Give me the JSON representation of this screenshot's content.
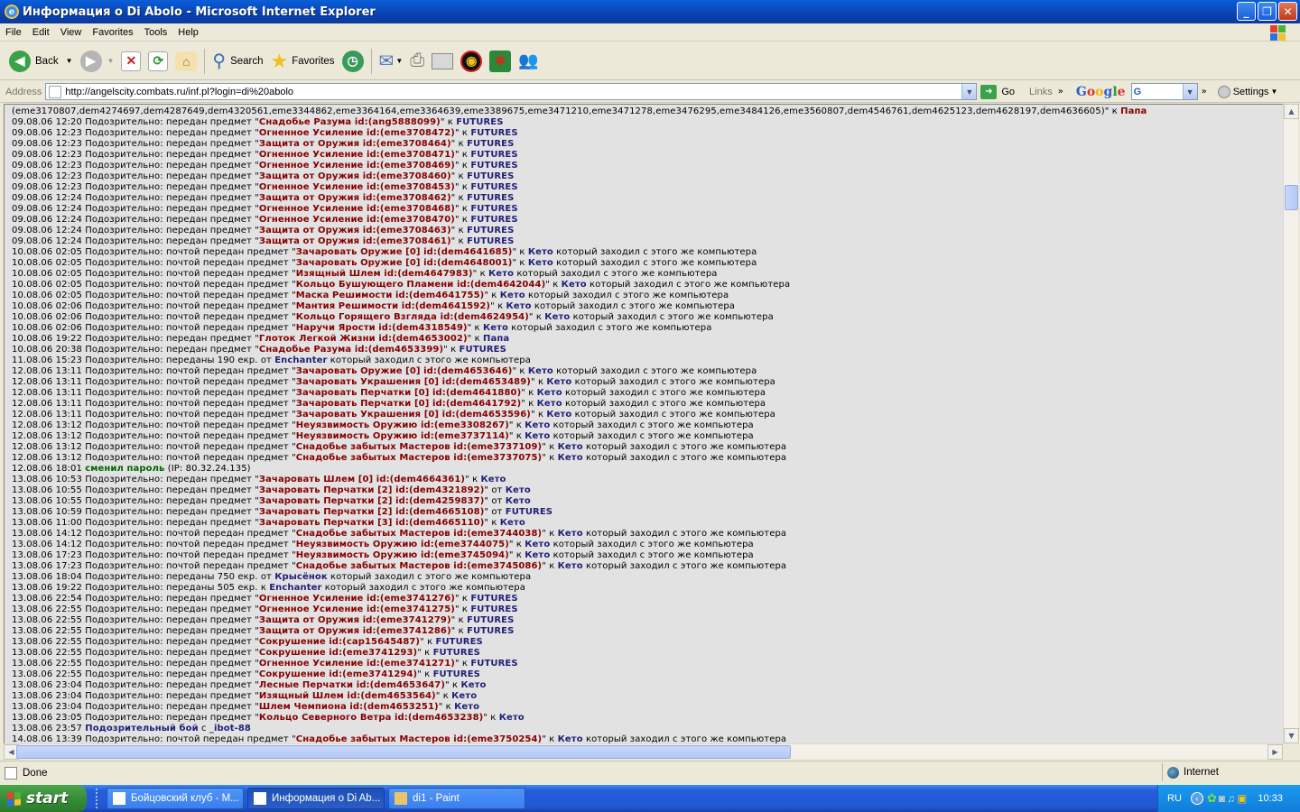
{
  "window": {
    "title": "Информация о Di Abolo - Microsoft Internet Explorer"
  },
  "menu": [
    "File",
    "Edit",
    "View",
    "Favorites",
    "Tools",
    "Help"
  ],
  "toolbar": {
    "back": "Back",
    "search": "Search",
    "favorites": "Favorites"
  },
  "address": {
    "label": "Address",
    "url": "http://angelscity.combats.ru/inf.pl?login=di%20abolo",
    "go": "Go",
    "links": "Links",
    "google": "Google",
    "google_field": "G",
    "settings": "Settings"
  },
  "log_lines": [
    [
      "(eme3170807,dem4274697,dem4287649,dem4320561,eme3344862,eme3364164,eme3364639,eme3389675,eme3471210,eme3471278,eme3476295,eme3484126,eme3560807,dem4546761,dem4625123,dem4628197,dem4636605)\" к ",
      "Папа",
      "",
      ""
    ],
    [
      "09.08.06 12:20 Подозрительно: передан предмет \"",
      "Снадобье Разума id:(ang5888099)",
      "\" к ",
      "FUTURES"
    ],
    [
      "09.08.06 12:23 Подозрительно: передан предмет \"",
      "Огненное Усиление id:(eme3708472)",
      "\" к ",
      "FUTURES"
    ],
    [
      "09.08.06 12:23 Подозрительно: передан предмет \"",
      "Защита от Оружия id:(eme3708464)",
      "\" к ",
      "FUTURES"
    ],
    [
      "09.08.06 12:23 Подозрительно: передан предмет \"",
      "Огненное Усиление id:(eme3708471)",
      "\" к ",
      "FUTURES"
    ],
    [
      "09.08.06 12:23 Подозрительно: передан предмет \"",
      "Огненное Усиление id:(eme3708469)",
      "\" к ",
      "FUTURES"
    ],
    [
      "09.08.06 12:23 Подозрительно: передан предмет \"",
      "Защита от Оружия id:(eme3708460)",
      "\" к ",
      "FUTURES"
    ],
    [
      "09.08.06 12:23 Подозрительно: передан предмет \"",
      "Огненное Усиление id:(eme3708453)",
      "\" к ",
      "FUTURES"
    ],
    [
      "09.08.06 12:24 Подозрительно: передан предмет \"",
      "Защита от Оружия id:(eme3708462)",
      "\" к ",
      "FUTURES"
    ],
    [
      "09.08.06 12:24 Подозрительно: передан предмет \"",
      "Огненное Усиление id:(eme3708468)",
      "\" к ",
      "FUTURES"
    ],
    [
      "09.08.06 12:24 Подозрительно: передан предмет \"",
      "Огненное Усиление id:(eme3708470)",
      "\" к ",
      "FUTURES"
    ],
    [
      "09.08.06 12:24 Подозрительно: передан предмет \"",
      "Защита от Оружия id:(eme3708463)",
      "\" к ",
      "FUTURES"
    ],
    [
      "09.08.06 12:24 Подозрительно: передан предмет \"",
      "Защита от Оружия id:(eme3708461)",
      "\" к ",
      "FUTURES"
    ],
    [
      "10.08.06 02:05 Подозрительно: почтой передан предмет \"",
      "Зачаровать Оружие [0] id:(dem4641685)",
      "\" к ",
      "Кето",
      "который заходил с этого же компьютера"
    ],
    [
      "10.08.06 02:05 Подозрительно: почтой передан предмет \"",
      "Зачаровать Оружие [0] id:(dem4648001)",
      "\" к ",
      "Кето",
      "который заходил с этого же компьютера"
    ],
    [
      "10.08.06 02:05 Подозрительно: почтой передан предмет \"",
      "Изящный Шлем id:(dem4647983)",
      "\" к ",
      "Кето",
      "который заходил с этого же компьютера"
    ],
    [
      "10.08.06 02:05 Подозрительно: почтой передан предмет \"",
      "Кольцо Бушующего Пламени id:(dem4642044)",
      "\" к ",
      "Кето",
      "который заходил с этого же компьютера"
    ],
    [
      "10.08.06 02:05 Подозрительно: почтой передан предмет \"",
      "Маска Решимости id:(dem4641755)",
      "\" к ",
      "Кето",
      "который заходил с этого же компьютера"
    ],
    [
      "10.08.06 02:06 Подозрительно: почтой передан предмет \"",
      "Мантия Решимости id:(dem4641592)",
      "\" к ",
      "Кето",
      "который заходил с этого же компьютера"
    ],
    [
      "10.08.06 02:06 Подозрительно: почтой передан предмет \"",
      "Кольцо Горящего Взгляда id:(dem4624954)",
      "\" к ",
      "Кето",
      "который заходил с этого же компьютера"
    ],
    [
      "10.08.06 02:06 Подозрительно: почтой передан предмет \"",
      "Наручи Ярости id:(dem4318549)",
      "\" к ",
      "Кето",
      "который заходил с этого же компьютера"
    ],
    [
      "10.08.06 19:22 Подозрительно: передан предмет \"",
      "Глоток Легкой Жизни id:(dem4653002)",
      "\" к ",
      "Папа"
    ],
    [
      "10.08.06 20:38 Подозрительно: передан предмет \"",
      "Снадобье Разума id:(dem4653399)",
      "\" к ",
      "FUTURES"
    ],
    [
      "11.08.06 15:23 Подозрительно: переданы 190 екр. от ",
      "",
      "",
      "Enchanter",
      "который заходил с этого же компьютера"
    ],
    [
      "12.08.06 13:11 Подозрительно: почтой передан предмет \"",
      "Зачаровать Оружие [0] id:(dem4653646)",
      "\" к ",
      "Кето",
      "который заходил с этого же компьютера"
    ],
    [
      "12.08.06 13:11 Подозрительно: почтой передан предмет \"",
      "Зачаровать Украшения [0] id:(dem4653489)",
      "\" к ",
      "Кето",
      "который заходил с этого же компьютера"
    ],
    [
      "12.08.06 13:11 Подозрительно: почтой передан предмет \"",
      "Зачаровать Перчатки [0] id:(dem4641880)",
      "\" к ",
      "Кето",
      "который заходил с этого же компьютера"
    ],
    [
      "12.08.06 13:11 Подозрительно: почтой передан предмет \"",
      "Зачаровать Перчатки [0] id:(dem4641792)",
      "\" к ",
      "Кето",
      "который заходил с этого же компьютера"
    ],
    [
      "12.08.06 13:11 Подозрительно: почтой передан предмет \"",
      "Зачаровать Украшения [0] id:(dem4653596)",
      "\" к ",
      "Кето",
      "который заходил с этого же компьютера"
    ],
    [
      "12.08.06 13:12 Подозрительно: почтой передан предмет \"",
      "Неуязвимость Оружию id:(eme3308267)",
      "\" к ",
      "Кето",
      "который заходил с этого же компьютера"
    ],
    [
      "12.08.06 13:12 Подозрительно: почтой передан предмет \"",
      "Неуязвимость Оружию id:(eme3737114)",
      "\" к ",
      "Кето",
      "который заходил с этого же компьютера"
    ],
    [
      "12.08.06 13:12 Подозрительно: почтой передан предмет \"",
      "Снадобье забытых Мастеров id:(eme3737109)",
      "\" к ",
      "Кето",
      "который заходил с этого же компьютера"
    ],
    [
      "12.08.06 13:12 Подозрительно: почтой передан предмет \"",
      "Снадобье забытых Мастеров id:(eme3737075)",
      "\" к ",
      "Кето",
      "который заходил с этого же компьютера"
    ],
    [
      "PW",
      "12.08.06 18:01 ",
      "сменил пароль",
      " (IP: 80.32.24.135)"
    ],
    [
      "13.08.06 10:53 Подозрительно: передан предмет \"",
      "Зачаровать Шлем [0] id:(dem4664361)",
      "\" к ",
      "Кето"
    ],
    [
      "13.08.06 10:55 Подозрительно: передан предмет \"",
      "Зачаровать Перчатки [2] id:(dem4321892)",
      "\" от ",
      "Кето"
    ],
    [
      "13.08.06 10:55 Подозрительно: передан предмет \"",
      "Зачаровать Перчатки [2] id:(dem4259837)",
      "\" от ",
      "Кето"
    ],
    [
      "13.08.06 10:59 Подозрительно: передан предмет \"",
      "Зачаровать Перчатки [2] id:(dem4665108)",
      "\" от ",
      "FUTURES"
    ],
    [
      "13.08.06 11:00 Подозрительно: передан предмет \"",
      "Зачаровать Перчатки [3] id:(dem4665110)",
      "\" к ",
      "Кето"
    ],
    [
      "13.08.06 14:12 Подозрительно: почтой передан предмет \"",
      "Снадобье забытых Мастеров id:(eme3744038)",
      "\" к ",
      "Кето",
      "который заходил с этого же компьютера"
    ],
    [
      "13.08.06 14:12 Подозрительно: почтой передан предмет \"",
      "Неуязвимость Оружию id:(eme3744075)",
      "\" к ",
      "Кето",
      "который заходил с этого же компьютера"
    ],
    [
      "13.08.06 17:23 Подозрительно: почтой передан предмет \"",
      "Неуязвимость Оружию id:(eme3745094)",
      "\" к ",
      "Кето",
      "который заходил с этого же компьютера"
    ],
    [
      "13.08.06 17:23 Подозрительно: почтой передан предмет \"",
      "Снадобье забытых Мастеров id:(eme3745086)",
      "\" к ",
      "Кето",
      "который заходил с этого же компьютера"
    ],
    [
      "13.08.06 18:04 Подозрительно: переданы 750 екр. от ",
      "",
      "",
      "Крысёнок",
      "который заходил с этого же компьютера"
    ],
    [
      "13.08.06 19:22 Подозрительно: переданы 505 екр. к ",
      "",
      "",
      "Enchanter",
      "который заходил с этого же компьютера"
    ],
    [
      "13.08.06 22:54 Подозрительно: передан предмет \"",
      "Огненное Усиление id:(eme3741276)",
      "\" к ",
      "FUTURES"
    ],
    [
      "13.08.06 22:55 Подозрительно: передан предмет \"",
      "Огненное Усиление id:(eme3741275)",
      "\" к ",
      "FUTURES"
    ],
    [
      "13.08.06 22:55 Подозрительно: передан предмет \"",
      "Защита от Оружия id:(eme3741279)",
      "\" к ",
      "FUTURES"
    ],
    [
      "13.08.06 22:55 Подозрительно: передан предмет \"",
      "Защита от Оружия id:(eme3741286)",
      "\" к ",
      "FUTURES"
    ],
    [
      "13.08.06 22:55 Подозрительно: передан предмет \"",
      "Сокрушение id:(cap15645487)",
      "\" к ",
      "FUTURES"
    ],
    [
      "13.08.06 22:55 Подозрительно: передан предмет \"",
      "Сокрушение id:(eme3741293)",
      "\" к ",
      "FUTURES"
    ],
    [
      "13.08.06 22:55 Подозрительно: передан предмет \"",
      "Огненное Усиление id:(eme3741271)",
      "\" к ",
      "FUTURES"
    ],
    [
      "13.08.06 22:55 Подозрительно: передан предмет \"",
      "Сокрушение id:(eme3741294)",
      "\" к ",
      "FUTURES"
    ],
    [
      "13.08.06 23:04 Подозрительно: передан предмет \"",
      "Лесные Перчатки id:(dem4653647)",
      "\" к ",
      "Кето"
    ],
    [
      "13.08.06 23:04 Подозрительно: передан предмет \"",
      "Изящный Шлем id:(dem4653564)",
      "\" к ",
      "Кето"
    ],
    [
      "13.08.06 23:04 Подозрительно: передан предмет \"",
      "Шлем Чемпиона id:(dem4653251)",
      "\" к ",
      "Кето"
    ],
    [
      "13.08.06 23:05 Подозрительно: передан предмет \"",
      "Кольцо Северного Ветра id:(dem4653238)",
      "\" к ",
      "Кето"
    ],
    [
      "SB",
      "13.08.06 23:57 ",
      "Подозрительный бой",
      " с ",
      "_ibot-88"
    ],
    [
      "14.08.06 13:39 Подозрительно: почтой передан предмет \"",
      "Снадобье забытых Мастеров id:(eme3750254)",
      "\" к ",
      "Кето",
      "который заходил с этого же компьютера"
    ]
  ],
  "status": {
    "text": "Done",
    "zone": "Internet"
  },
  "taskbar": {
    "start": "start",
    "tasks": [
      "Бойцовский клуб - M...",
      "Информация о Di Ab...",
      "di1 - Paint"
    ],
    "lang": "RU",
    "time": "10:33"
  },
  "colors": {
    "title_bar": "#0842b0",
    "item": "#880000",
    "user": "#1f1f7a",
    "password": "#006600",
    "page_bg": "#e2e2e2"
  }
}
